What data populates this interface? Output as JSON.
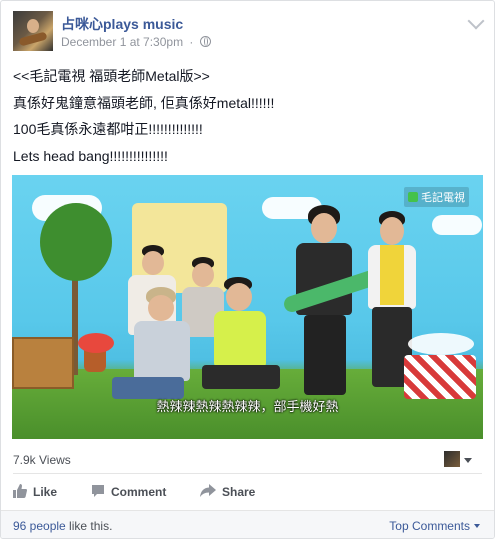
{
  "post": {
    "page_name": "占咪心plays music",
    "timestamp": "December 1 at 7:30pm",
    "separator": "·",
    "privacy_icon": "globe-icon",
    "lines": [
      "<<毛記電視 福頭老師Metal版>>",
      "真係好鬼鐘意福頭老師, 佢真係好metal!!!!!!",
      "100毛真係永遠都咁正!!!!!!!!!!!!!!",
      "Lets head bang!!!!!!!!!!!!!!!"
    ]
  },
  "video": {
    "channel_logo": "毛記電視",
    "subtitle": "熱辣辣熱辣熱辣辣，部手機好熱"
  },
  "stats": {
    "views": "7.9k Views"
  },
  "actions": {
    "like_label": "Like",
    "comment_label": "Comment",
    "share_label": "Share"
  },
  "footer": {
    "likes_link": "96 people",
    "likes_suffix": " like this.",
    "top_comments": "Top Comments"
  },
  "colors": {
    "link": "#3b5998",
    "meta": "#90949c",
    "text": "#141823"
  }
}
